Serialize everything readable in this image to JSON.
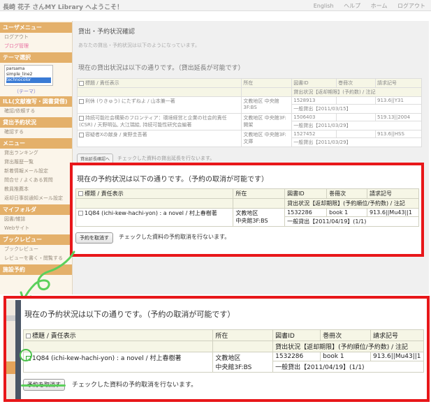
{
  "header": {
    "welcome": "長崎 花子 さんMY Library へようこそ！",
    "nav": [
      "English",
      "ヘルプ",
      "ホーム",
      "ログアウト"
    ]
  },
  "sidebar": {
    "user_menu": "ユーザメニュー",
    "logout": "ログアウト",
    "blog": "ブログ管理",
    "theme_select_head": "テーマ選択",
    "theme_options": [
      "parsama",
      "simple_line2",
      "technocolor"
    ],
    "theme_label": "（テーマ）",
    "ill_head": "ILL(文献複写・図書貸借)",
    "ill_item": "確認/依頼する",
    "loan_head": "貸出予約状況",
    "loan_item": "確認する",
    "menu_head": "メニュー",
    "menu_items": [
      "貸出ランキング",
      "貸出履歴一覧",
      "新着情報メール設定",
      "問合せ / よくある質問",
      "教員推薦本",
      "返却日事前通知メール設定"
    ],
    "myfolder_head": "マイフォルダ",
    "myfolder_items": [
      "図書/雑誌",
      "Webサイト"
    ],
    "review_head": "ブックレビュー",
    "review_items": [
      "ブックレビュー",
      "レビューを書く・閲覧する"
    ],
    "last_head": "施設予約"
  },
  "main": {
    "title": "貸出・予約状況確認",
    "subtitle": "あなたの貸出・予約状況は以下のようになっています。",
    "loan_section_title": "現在の貸出状況は以下の通りです。（貸出延長が可能です）",
    "loan_headers": [
      "標題 / 責任表示",
      "所在",
      "図書ID",
      "巻冊次",
      "請求記号"
    ],
    "loan_subheader": "貸出状況【返却期限】(予約数) / 注記",
    "loans": [
      {
        "title": "利休 (りきゅう) にたずねよ / 山本兼一著",
        "location": "文教地区 中央館3F:BS",
        "id": "1528913",
        "vol": "",
        "call": "913.6||Y31",
        "status": "一般貸出【2011/03/15】"
      },
      {
        "title": "持続可能社会構築のフロンティア：環境経営と企業の社会的責任(CSR) / 天野明弘, 大江瑞絵, 持続可能性研究会編著",
        "location": "文教地区 中央館3F:開架",
        "id": "1506403",
        "vol": "",
        "call": "519.13||2004",
        "status": "一般貸出【2011/03/29】"
      },
      {
        "title": "容疑者Xの献身 / 東野圭吾著",
        "location": "文教地区 中央館3F:文庫",
        "id": "1527452",
        "vol": "",
        "call": "913.6||HSS",
        "status": "一般貸出【2011/03/29】"
      }
    ],
    "loan_button": "貸出延長確認へ",
    "loan_note": "チェックした資料の貸出延長を行ないます。"
  },
  "reservation": {
    "title": "現在の予約状況は以下の通りです。（予約の取消が可能です）",
    "headers": [
      "標題 / 責任表示",
      "所在",
      "図書ID",
      "巻冊次",
      "請求記号"
    ],
    "subheader": "貸出状況【返却期限】(予約順位/予約数) / 注記",
    "row": {
      "title": "1Q84 (ichi-kew-hachi-yon) : a novel / 村上春樹著",
      "location_1": "文教地区",
      "location_2": "中央館3F:BS",
      "id": "1532286",
      "vol": "book 1",
      "call": "913.6||Mu43||1",
      "status": "一般貸出【2011/04/19】(1/1)"
    },
    "button": "予約を取消す",
    "note": "チェックした資料の予約取消を行ないます。"
  },
  "annotation_color": "#e8171a"
}
